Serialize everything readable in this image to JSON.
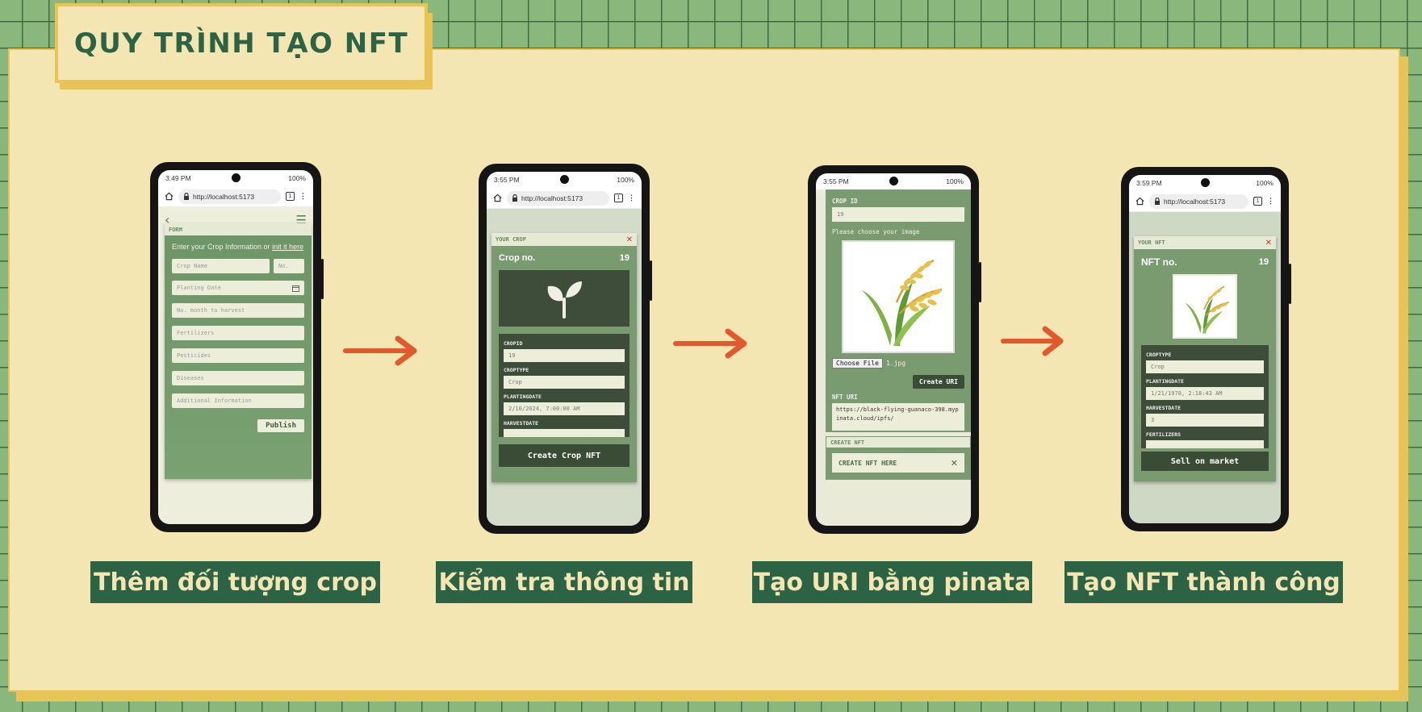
{
  "title": "QUY TRÌNH TẠO NFT",
  "arrow_color": "#e05a2e",
  "steps": [
    {
      "caption": "Thêm đối tượng crop",
      "time": "3:49 PM",
      "battery": "100%",
      "url": "http://localhost:5173",
      "tabs": "1",
      "form": {
        "header": "FORM",
        "intro": "Enter your Crop Information or",
        "link": "init it here",
        "crop_name_placeholder": "Crop Name",
        "no_placeholder": "No.",
        "planting_date_placeholder": "Planting Date",
        "months_placeholder": "No. month to harvest",
        "fertilizers_placeholder": "Fertilizers",
        "pesticides_placeholder": "Pesticides",
        "diseases_placeholder": "Diseases",
        "additional_placeholder": "Additional Information",
        "publish_label": "Publish"
      }
    },
    {
      "caption": "Kiểm tra thông tin",
      "time": "3:55 PM",
      "battery": "100%",
      "url": "http://localhost:5173",
      "tabs": "1",
      "modal": {
        "header": "YOUR CROP",
        "close": "✕",
        "crop_label": "Crop no.",
        "crop_number": "19",
        "fields": [
          {
            "label": "CROPID",
            "value": "19"
          },
          {
            "label": "CROPTYPE",
            "value": "Crop"
          },
          {
            "label": "PLANTINGDATE",
            "value": "2/10/2024, 7:00:00 AM"
          },
          {
            "label": "HARVESTDATE",
            "value": ""
          }
        ],
        "button": "Create Crop NFT"
      }
    },
    {
      "caption": "Tạo URI bằng pinata",
      "time": "3:55 PM",
      "battery": "100%",
      "uri": {
        "crop_id_label": "CROP ID",
        "crop_id_value": "19",
        "choose_prompt": "Please choose your image",
        "choose_file": "Choose File",
        "file_name": "1.jpg",
        "create_uri": "Create URI",
        "nft_uri_label": "NFT URI",
        "nft_uri_value": "https://black-flying-guanaco-398.mypinata.cloud/ipfs/",
        "create_nft_header": "CREATE NFT",
        "create_nft_here": "CREATE NFT HERE",
        "close": "✕"
      }
    },
    {
      "caption": "Tạo NFT thành công",
      "time": "3:59 PM",
      "battery": "100%",
      "url": "http://localhost:5173",
      "tabs": "1",
      "nft": {
        "header": "YOUR NFT",
        "close": "✕",
        "nft_label": "NFT no.",
        "nft_number": "19",
        "fields": [
          {
            "label": "CROPTYPE",
            "value": "Crop"
          },
          {
            "label": "PLANTINGDATE",
            "value": "1/21/1970, 2:18:43 AM"
          },
          {
            "label": "HARVESTDATE",
            "value": "3"
          },
          {
            "label": "FERTILIZERS",
            "value": ""
          }
        ],
        "button": "Sell on market"
      }
    }
  ]
}
